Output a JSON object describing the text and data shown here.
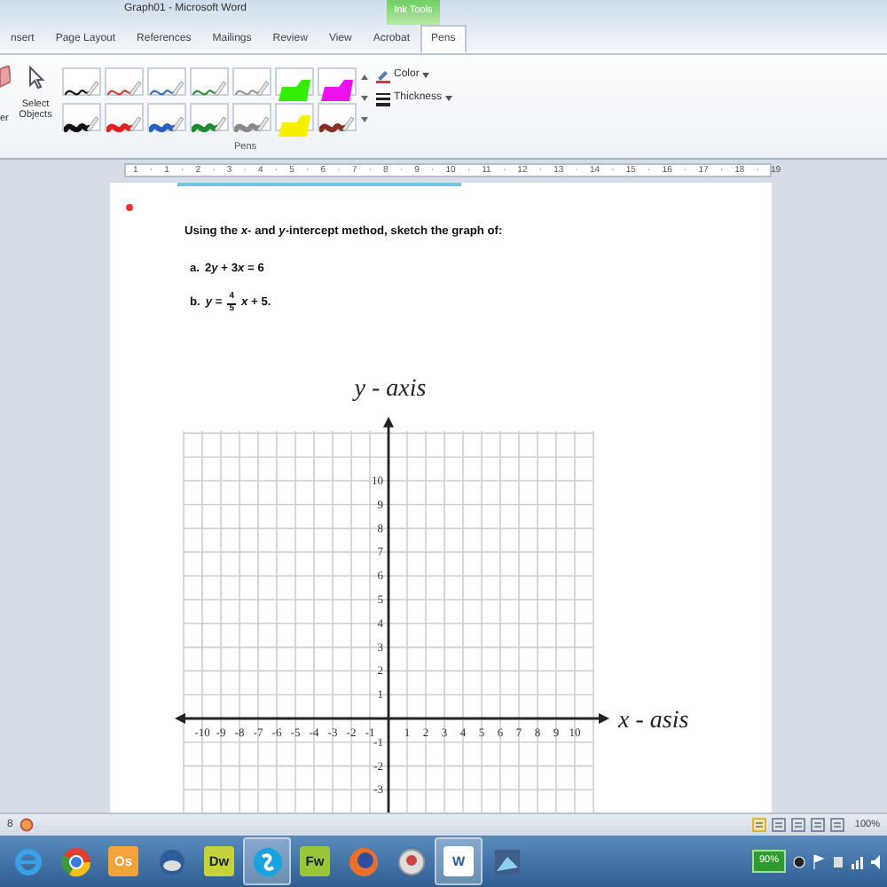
{
  "window": {
    "title": "Graph01 - Microsoft Word",
    "context_tab": "Ink Tools"
  },
  "tabs": [
    {
      "label": "nsert",
      "selected": false
    },
    {
      "label": "Page Layout",
      "selected": false
    },
    {
      "label": "References",
      "selected": false
    },
    {
      "label": "Mailings",
      "selected": false
    },
    {
      "label": "Review",
      "selected": false
    },
    {
      "label": "View",
      "selected": false
    },
    {
      "label": "Acrobat",
      "selected": false
    },
    {
      "label": "Pens",
      "selected": true
    }
  ],
  "ribbon": {
    "eraser_label": "er",
    "select_label": "Select Objects",
    "pens": [
      {
        "kind": "thin",
        "color": "#111111"
      },
      {
        "kind": "thin",
        "color": "#d04040"
      },
      {
        "kind": "thin",
        "color": "#3a6fc0"
      },
      {
        "kind": "thin",
        "color": "#2f8f3f"
      },
      {
        "kind": "thin",
        "color": "#9a9a9a"
      },
      {
        "kind": "highlighter",
        "color": "#33ee00"
      },
      {
        "kind": "highlighter",
        "color": "#ee11ee"
      },
      {
        "kind": "thick",
        "color": "#111111"
      },
      {
        "kind": "thick",
        "color": "#dd2020"
      },
      {
        "kind": "thick",
        "color": "#2a60c0"
      },
      {
        "kind": "thick",
        "color": "#1f8a2f"
      },
      {
        "kind": "thick",
        "color": "#8a8a8a"
      },
      {
        "kind": "highlighter",
        "color": "#f4f000"
      },
      {
        "kind": "thick",
        "color": "#8a2f25"
      }
    ],
    "color_label": "Color",
    "thickness_label": "Thickness",
    "group_label": "Pens"
  },
  "ruler": "1 · 1 · 2 · 3 · 4 · 5 · 6 · 7 · 8 · 9 · 10 · 11 · 12 · 13 · 14 · 15 · 16 · 17 · 18 · 19",
  "document": {
    "instruction": "Using the *x*- and *y*-intercept method, sketch the graph of:",
    "items": [
      {
        "label": "a.",
        "segments": [
          {
            "text": "2",
            "italic": false
          },
          {
            "text": "y",
            "italic": true
          },
          {
            "text": "+ 3",
            "italic": false
          },
          {
            "text": "x",
            "italic": true
          },
          {
            "text": "= 6",
            "italic": false
          }
        ]
      },
      {
        "label": "b.",
        "lhs": "*y* =",
        "numerator": "4",
        "denominator": "5",
        "rhs": "*x* + 5."
      }
    ],
    "graph": {
      "chart_data": {
        "type": "scatter",
        "grid": true,
        "xlabel": "x - asis",
        "ylabel": "y - axis",
        "xlim": [
          -11,
          11
        ],
        "ylim": [
          -4.2,
          12.1
        ],
        "xticks": [
          -10,
          -9,
          -8,
          -7,
          -6,
          -5,
          -4,
          -3,
          -2,
          -1,
          1,
          2,
          3,
          4,
          5,
          6,
          7,
          8,
          9,
          10
        ],
        "yticks": [
          10,
          9,
          8,
          7,
          6,
          5,
          4,
          3,
          2,
          1,
          -1,
          -2,
          -3
        ]
      }
    }
  },
  "status_bar": {
    "page": "8",
    "zoom": "100%"
  },
  "taskbar": [
    {
      "kind": "ie",
      "active": false
    },
    {
      "kind": "chrome",
      "active": false
    },
    {
      "kind": "outlook",
      "text": "Os",
      "active": false
    },
    {
      "kind": "thunderbird",
      "active": false
    },
    {
      "kind": "dreamweaver",
      "text": "Dw",
      "active": false
    },
    {
      "kind": "skype",
      "active": true
    },
    {
      "kind": "fireworks",
      "text": "Fw",
      "active": false
    },
    {
      "kind": "firefox",
      "active": false
    },
    {
      "kind": "app",
      "active": false
    },
    {
      "kind": "word",
      "text": "W",
      "active": true
    },
    {
      "kind": "photo",
      "active": false
    }
  ],
  "tray": {
    "battery": "90%"
  }
}
